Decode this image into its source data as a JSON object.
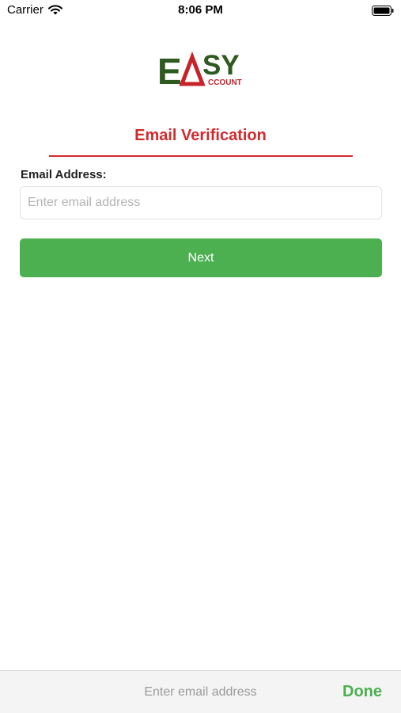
{
  "status_bar": {
    "carrier": "Carrier",
    "time": "8:06 PM"
  },
  "logo": {
    "letter_e": "E",
    "letters_sy": "SY",
    "subtext": "CCOUNT",
    "colors": {
      "green": "#2e5a1f",
      "red": "#c4232a"
    }
  },
  "page": {
    "title": "Email Verification"
  },
  "form": {
    "email_label": "Email Address:",
    "email_placeholder": "Enter email address",
    "email_value": "",
    "next_label": "Next"
  },
  "accessory_bar": {
    "hint": "Enter email address",
    "done_label": "Done"
  },
  "colors": {
    "accent_red": "#d12a2e",
    "button_green": "#4caf50"
  }
}
